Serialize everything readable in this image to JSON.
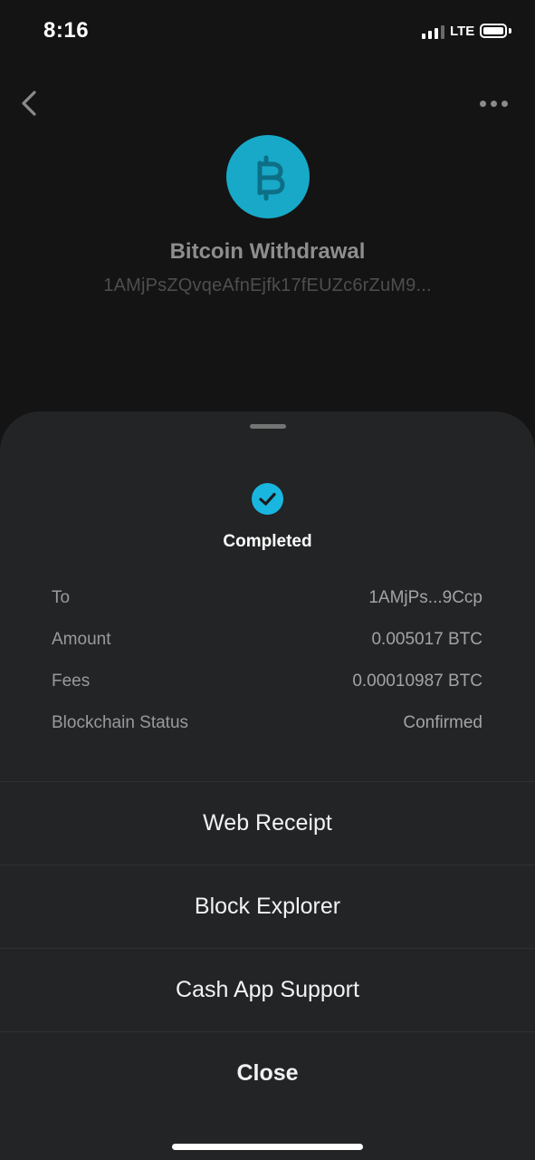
{
  "status_bar": {
    "time": "8:16",
    "network": "LTE"
  },
  "header": {
    "back_icon": "chevron-left-icon",
    "more_icon": "ellipsis-icon",
    "avatar_icon": "bitcoin-icon",
    "avatar_color": "#18a9c9",
    "title": "Bitcoin Withdrawal",
    "address": "1AMjPsZQvqeAfnEjfk17fEUZc6rZuM9..."
  },
  "sheet": {
    "status_icon": "check-circle-icon",
    "status_color": "#19b6e0",
    "status": "Completed",
    "details": [
      {
        "label": "To",
        "value": "1AMjPs...9Ccp"
      },
      {
        "label": "Amount",
        "value": "0.005017 BTC"
      },
      {
        "label": "Fees",
        "value": "0.00010987 BTC"
      },
      {
        "label": "Blockchain Status",
        "value": "Confirmed"
      }
    ],
    "actions": {
      "web_receipt": "Web Receipt",
      "block_explorer": "Block Explorer",
      "support": "Cash App Support",
      "close": "Close"
    }
  }
}
